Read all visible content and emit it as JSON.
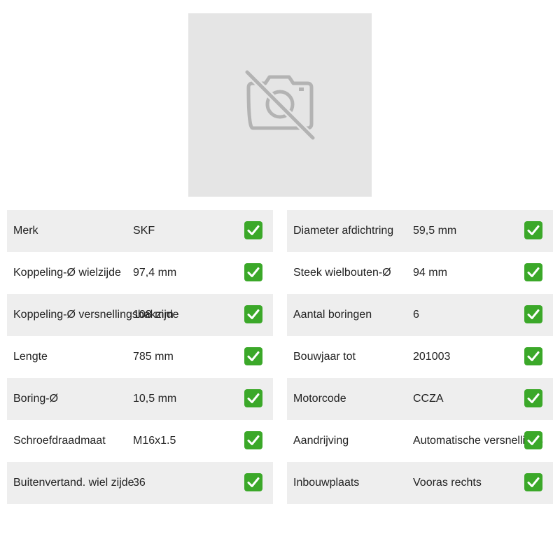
{
  "product_image": {
    "icon": "no-camera-icon"
  },
  "left_table": {
    "rows": [
      {
        "label": "Merk",
        "value": "SKF",
        "check_icon": "check-icon"
      },
      {
        "label": "Koppeling-Ø wielzijde",
        "value": "97,4 mm",
        "check_icon": "check-icon"
      },
      {
        "label": "Koppeling-Ø versnellingsbakzijde",
        "value": "108 mm",
        "check_icon": "check-icon"
      },
      {
        "label": "Lengte",
        "value": "785 mm",
        "check_icon": "check-icon"
      },
      {
        "label": "Boring-Ø",
        "value": "10,5 mm",
        "check_icon": "check-icon"
      },
      {
        "label": "Schroefdraadmaat",
        "value": "M16x1.5",
        "check_icon": "check-icon"
      },
      {
        "label": "Buitenvertand. wiel zijde",
        "value": "36",
        "check_icon": "check-icon"
      }
    ]
  },
  "right_table": {
    "rows": [
      {
        "label": "Diameter afdichtring",
        "value": "59,5 mm",
        "check_icon": "check-icon"
      },
      {
        "label": "Steek wielbouten-Ø",
        "value": "94 mm",
        "check_icon": "check-icon"
      },
      {
        "label": "Aantal boringen",
        "value": "6",
        "check_icon": "check-icon"
      },
      {
        "label": "Bouwjaar tot",
        "value": "201003",
        "check_icon": "check-icon"
      },
      {
        "label": "Motorcode",
        "value": "CCZA",
        "check_icon": "check-icon"
      },
      {
        "label": "Aandrijving",
        "value": "Automatische versnellings",
        "check_icon": "check-icon"
      },
      {
        "label": "Inbouwplaats",
        "value": "Vooras rechts",
        "check_icon": "check-icon"
      }
    ]
  },
  "colors": {
    "check_green": "#3ba829",
    "row_shade": "#eeeeee",
    "placeholder_bg": "#e5e5e5",
    "icon_gray": "#b3b3b3"
  }
}
